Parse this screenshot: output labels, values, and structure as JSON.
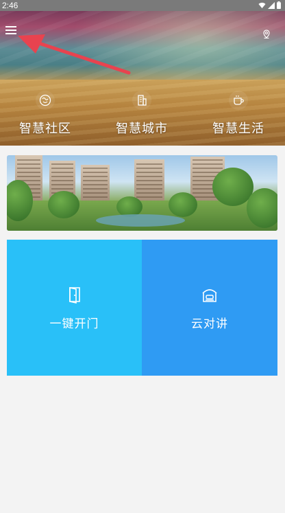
{
  "status_bar": {
    "time": "2:46"
  },
  "header": {
    "menu_icon": "hamburger-menu-icon",
    "location_icon": "location-pin-icon",
    "annotation": "red-arrow-pointing-to-menu"
  },
  "categories": [
    {
      "label": "智慧社区",
      "icon": "community-icon"
    },
    {
      "label": "智慧城市",
      "icon": "city-building-icon"
    },
    {
      "label": "智慧生活",
      "icon": "coffee-cup-icon"
    }
  ],
  "banner": {
    "image": "residential-garden-photo"
  },
  "tiles": [
    {
      "label": "一键开门",
      "icon": "door-icon",
      "color": "#29c0f8"
    },
    {
      "label": "云对讲",
      "icon": "intercom-phone-icon",
      "color": "#2f9bf3"
    }
  ],
  "colors": {
    "accent_light": "#29c0f8",
    "accent": "#2f9bf3",
    "background": "#f3f3f3",
    "arrow": "#e8434f"
  }
}
